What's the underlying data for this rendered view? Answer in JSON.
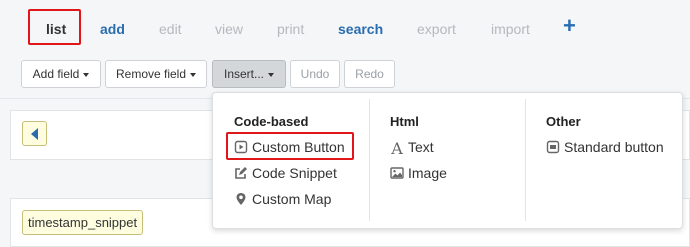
{
  "tabs": [
    {
      "label": "list",
      "state": "active"
    },
    {
      "label": "add",
      "state": "emphasized"
    },
    {
      "label": "edit",
      "state": "disabled"
    },
    {
      "label": "view",
      "state": "disabled"
    },
    {
      "label": "print",
      "state": "disabled"
    },
    {
      "label": "search",
      "state": "emphasized"
    },
    {
      "label": "export",
      "state": "disabled"
    },
    {
      "label": "import",
      "state": "disabled"
    },
    {
      "label": "+",
      "state": "emphasized"
    }
  ],
  "toolbar": {
    "add_field": "Add field",
    "remove_field": "Remove field",
    "insert": "Insert...",
    "undo": "Undo",
    "redo": "Redo"
  },
  "content": {
    "snippet_label": "timestamp_snippet"
  },
  "menu": {
    "code_based": {
      "heading": "Code-based",
      "items": [
        {
          "label": "Custom Button",
          "icon": "play-square-icon"
        },
        {
          "label": "Code Snippet",
          "icon": "edit-icon"
        },
        {
          "label": "Custom Map",
          "icon": "map-marker-icon"
        }
      ]
    },
    "html": {
      "heading": "Html",
      "items": [
        {
          "label": "Text",
          "icon": "font-icon"
        },
        {
          "label": "Image",
          "icon": "image-icon"
        }
      ]
    },
    "other": {
      "heading": "Other",
      "items": [
        {
          "label": "Standard button",
          "icon": "button-icon"
        }
      ]
    }
  },
  "colors": {
    "accent": "#2a6cb0",
    "highlight_border": "#e0161b",
    "tag_background": "#fffde0"
  }
}
